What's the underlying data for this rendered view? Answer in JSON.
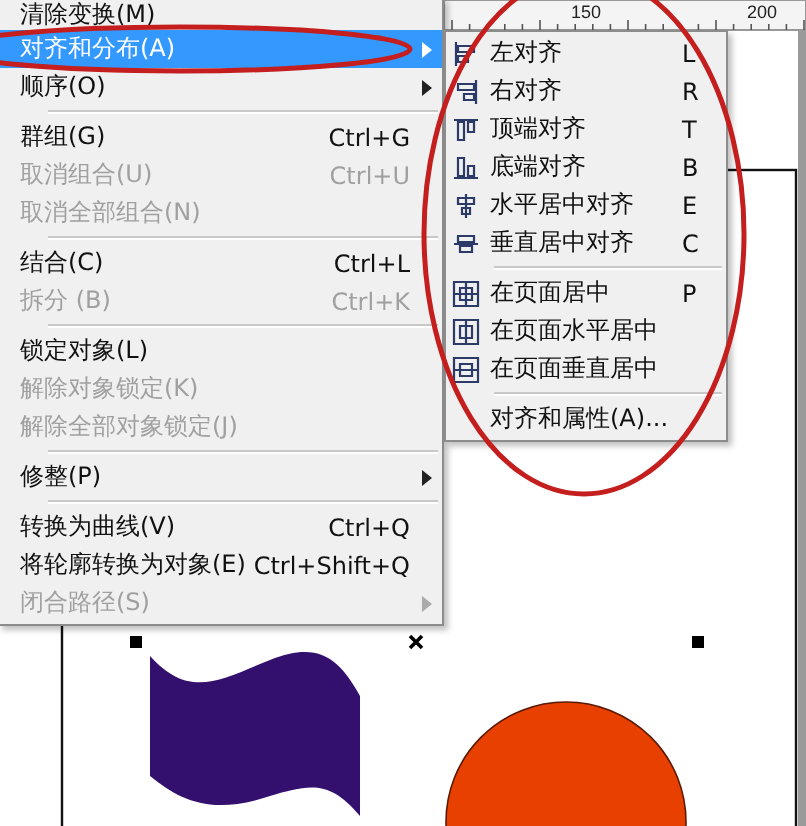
{
  "ruler": {
    "labels": [
      "150",
      "200"
    ]
  },
  "canvas": {
    "shapes": [
      {
        "kind": "wave",
        "color": "#33106e"
      },
      {
        "kind": "circle",
        "color": "#e84000"
      }
    ]
  },
  "main_menu": {
    "groups": [
      [
        {
          "label": "清除变换(M)",
          "disabled": false,
          "has_submenu": false,
          "selected": false
        },
        {
          "label": "对齐和分布(A)",
          "disabled": false,
          "has_submenu": true,
          "selected": true
        },
        {
          "label": "顺序(O)",
          "disabled": false,
          "has_submenu": true,
          "selected": false
        }
      ],
      [
        {
          "label": "群组(G)",
          "shortcut": "Ctrl+G",
          "disabled": false,
          "has_submenu": false,
          "selected": false
        },
        {
          "label": "取消组合(U)",
          "shortcut": "Ctrl+U",
          "disabled": true,
          "has_submenu": false,
          "selected": false
        },
        {
          "label": "取消全部组合(N)",
          "disabled": true,
          "has_submenu": false,
          "selected": false
        }
      ],
      [
        {
          "label": "结合(C)",
          "shortcut": "Ctrl+L",
          "disabled": false,
          "has_submenu": false,
          "selected": false
        },
        {
          "label": "拆分 (B)",
          "shortcut": "Ctrl+K",
          "disabled": true,
          "has_submenu": false,
          "selected": false
        }
      ],
      [
        {
          "label": "锁定对象(L)",
          "disabled": false,
          "has_submenu": false,
          "selected": false
        },
        {
          "label": "解除对象锁定(K)",
          "disabled": true,
          "has_submenu": false,
          "selected": false
        },
        {
          "label": "解除全部对象锁定(J)",
          "disabled": true,
          "has_submenu": false,
          "selected": false
        }
      ],
      [
        {
          "label": "修整(P)",
          "disabled": false,
          "has_submenu": true,
          "selected": false
        }
      ],
      [
        {
          "label": "转换为曲线(V)",
          "shortcut": "Ctrl+Q",
          "disabled": false,
          "has_submenu": false,
          "selected": false
        },
        {
          "label": "将轮廓转换为对象(E)",
          "shortcut": "Ctrl+Shift+Q",
          "disabled": false,
          "has_submenu": false,
          "selected": false
        },
        {
          "label": "闭合路径(S)",
          "disabled": true,
          "has_submenu": true,
          "selected": false
        }
      ]
    ]
  },
  "submenu": {
    "groups": [
      [
        {
          "kind": "align",
          "label": "左对齐",
          "shortcut": "L"
        },
        {
          "kind": "align",
          "label": "右对齐",
          "shortcut": "R"
        },
        {
          "kind": "align",
          "label": "顶端对齐",
          "shortcut": "T"
        },
        {
          "kind": "align",
          "label": "底端对齐",
          "shortcut": "B"
        },
        {
          "kind": "align",
          "label": "水平居中对齐",
          "shortcut": "E"
        },
        {
          "kind": "align",
          "label": "垂直居中对齐",
          "shortcut": "C"
        }
      ],
      [
        {
          "kind": "page",
          "label": "在页面居中",
          "shortcut": "P"
        },
        {
          "kind": "page",
          "label": "在页面水平居中"
        },
        {
          "kind": "page",
          "label": "在页面垂直居中"
        }
      ],
      [
        {
          "kind": "command",
          "label": "对齐和属性(A)..."
        }
      ]
    ]
  },
  "annotations": [
    {
      "kind": "ellipse"
    },
    {
      "kind": "ellipse"
    }
  ]
}
